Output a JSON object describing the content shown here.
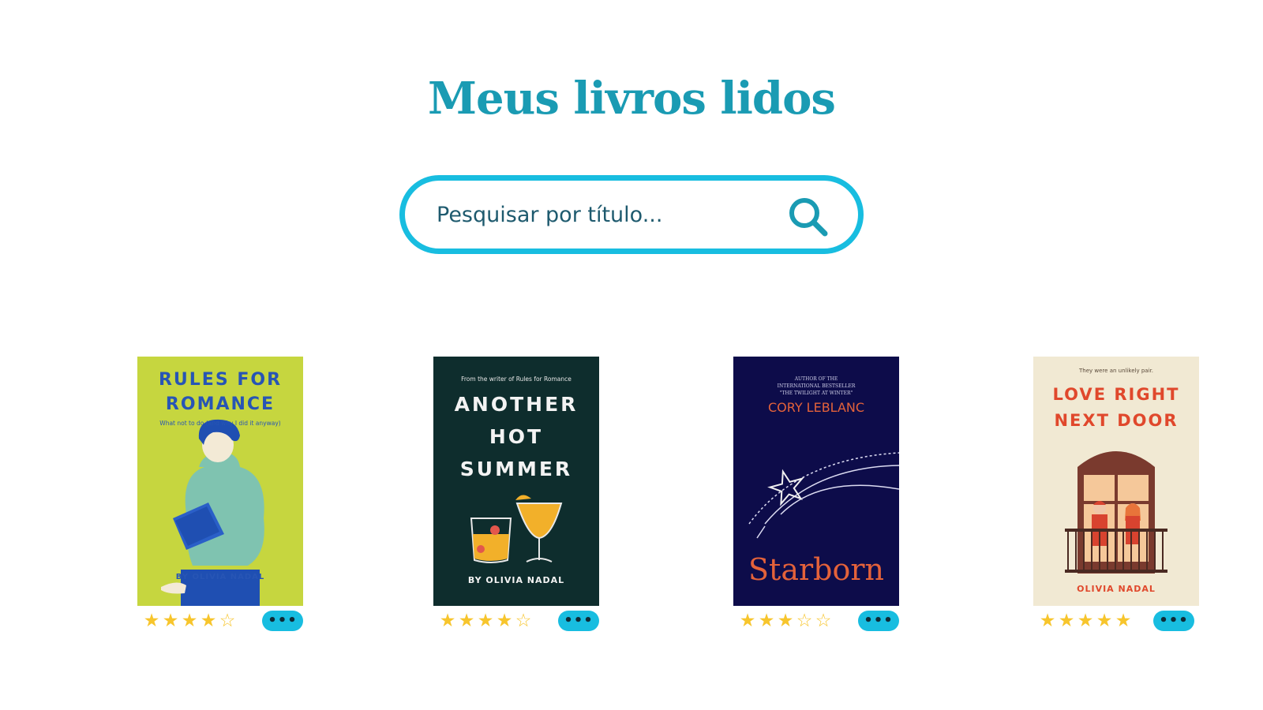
{
  "header": {
    "title": "Meus livros lidos"
  },
  "search": {
    "placeholder": "Pesquisar por título...",
    "value": "",
    "icon": "search-icon"
  },
  "colors": {
    "accent": "#18bde0",
    "title": "#1a9bb3",
    "star": "#f7c52c"
  },
  "books": [
    {
      "cover_lines": [
        "RULES FOR",
        "ROMANCE"
      ],
      "cover_tagline": "What not to do (and why I did it anyway)",
      "cover_author": "BY OLIVIA NADAL",
      "rating": 4,
      "max_rating": 5,
      "more_label": "•••"
    },
    {
      "cover_kicker": "From the writer of Rules for Romance",
      "cover_lines": [
        "ANOTHER",
        "HOT",
        "SUMMER"
      ],
      "cover_author": "BY OLIVIA NADAL",
      "rating": 4,
      "max_rating": 5,
      "more_label": "•••"
    },
    {
      "cover_kicker_lines": [
        "AUTHOR OF THE",
        "INTERNATIONAL BESTSELLER",
        "\"THE TWILIGHT AT WINTER\""
      ],
      "cover_author": "CORY LEBLANC",
      "cover_title": "Starborn",
      "rating": 3,
      "max_rating": 5,
      "more_label": "•••"
    },
    {
      "cover_kicker": "They were an unlikely pair.",
      "cover_lines": [
        "LOVE RIGHT",
        "NEXT DOOR"
      ],
      "cover_author": "OLIVIA NADAL",
      "rating": 5,
      "max_rating": 5,
      "more_label": "•••"
    }
  ]
}
